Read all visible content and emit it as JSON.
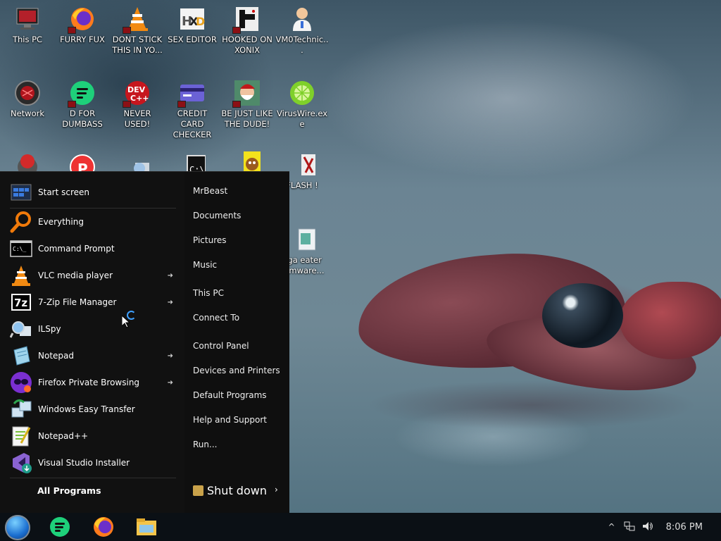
{
  "desktop": {
    "icons": [
      {
        "label": "This PC"
      },
      {
        "label": "FURRY FUX"
      },
      {
        "label": "DONT STICK THIS IN YO..."
      },
      {
        "label": "SEX EDITOR"
      },
      {
        "label": "HOOKED ON XONIX"
      },
      {
        "label": "VM0Technic..."
      },
      {
        "label": "Network"
      },
      {
        "label": "D FOR DUMBASS"
      },
      {
        "label": "NEVER USED!"
      },
      {
        "label": "CREDIT CARD CHECKER"
      },
      {
        "label": "BE JUST LIKE THE DUDE!"
      },
      {
        "label": "VirusWire.exe"
      },
      {
        "label": "FLASH !"
      },
      {
        "label": "gga eater somware..."
      }
    ]
  },
  "start_menu": {
    "pinned": [
      {
        "label": "Start screen",
        "icon": "start-screen-icon"
      },
      {
        "label": "Everything",
        "icon": "magnifier-icon"
      },
      {
        "label": "Command Prompt",
        "icon": "cmd-icon"
      },
      {
        "label": "VLC media player",
        "icon": "vlc-icon",
        "has_submenu": true
      },
      {
        "label": "7-Zip File Manager",
        "icon": "7zip-icon",
        "has_submenu": true
      },
      {
        "label": "ILSpy",
        "icon": "ilspy-icon"
      },
      {
        "label": "Notepad",
        "icon": "notepad-icon",
        "has_submenu": true
      },
      {
        "label": "Firefox Private Browsing",
        "icon": "firefox-private-icon",
        "has_submenu": true
      },
      {
        "label": "Windows Easy Transfer",
        "icon": "easy-transfer-icon"
      },
      {
        "label": "Notepad++",
        "icon": "notepadpp-icon"
      },
      {
        "label": "Visual Studio Installer",
        "icon": "vs-installer-icon"
      }
    ],
    "all_programs": "All Programs",
    "right_links": [
      "MrBeast",
      "Documents",
      "Pictures",
      "Music",
      "This PC",
      "Connect To",
      "Control Panel",
      "Devices and Printers",
      "Default Programs",
      "Help and Support",
      "Run..."
    ],
    "shutdown": {
      "label": "Shut down",
      "arrow": "›"
    }
  },
  "taskbar": {
    "apps": [
      "green-chat-icon",
      "firefox-icon",
      "file-explorer-icon"
    ],
    "tray": {
      "chevron": "^",
      "clock": "8:06 PM"
    }
  }
}
